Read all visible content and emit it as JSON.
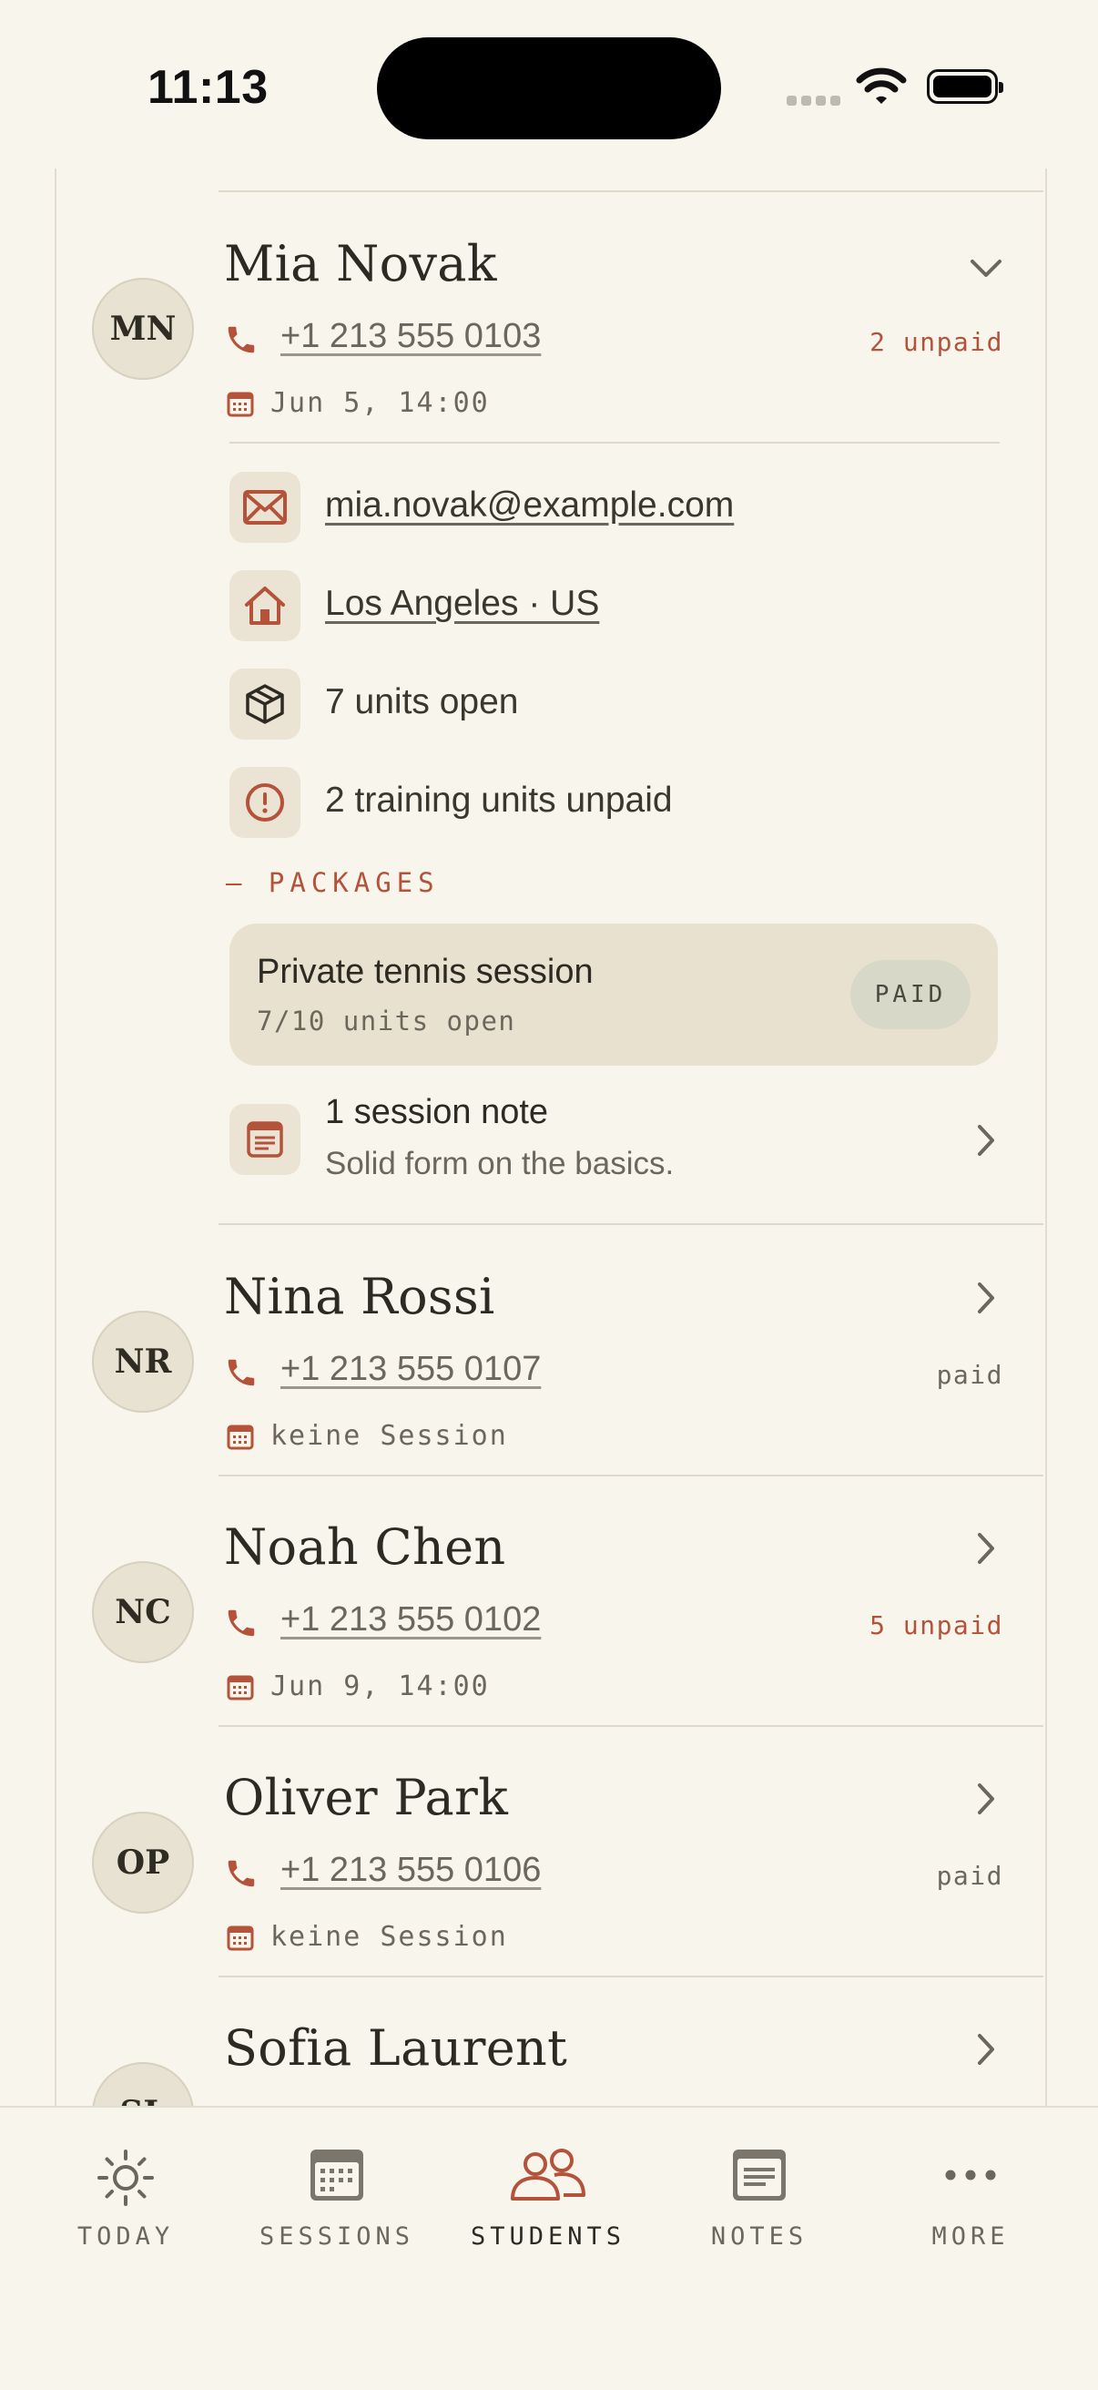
{
  "status_bar": {
    "time": "11:13"
  },
  "students": [
    {
      "initials": "MN",
      "name": "Mia Novak",
      "phone": "+1 213 555 0103",
      "payment": "2 unpaid",
      "payment_state": "unpaid",
      "next_session": "Jun 5, 14:00",
      "expanded": true,
      "details": {
        "email": "mia.novak@example.com",
        "location": "Los Angeles · US",
        "units_open": "7 units open",
        "unpaid_units": "2 training units unpaid",
        "packages_label": "— PACKAGES",
        "packages": [
          {
            "title": "Private tennis session",
            "units": "7/10 units open",
            "status": "PAID"
          }
        ],
        "note_title": "1 session note",
        "note_text": "Solid form on the basics."
      }
    },
    {
      "initials": "NR",
      "name": "Nina Rossi",
      "phone": "+1 213 555 0107",
      "payment": "paid",
      "payment_state": "paid",
      "next_session": "keine Session"
    },
    {
      "initials": "NC",
      "name": "Noah Chen",
      "phone": "+1 213 555 0102",
      "payment": "5 unpaid",
      "payment_state": "unpaid",
      "next_session": "Jun 9, 14:00"
    },
    {
      "initials": "OP",
      "name": "Oliver Park",
      "phone": "+1 213 555 0106",
      "payment": "paid",
      "payment_state": "paid",
      "next_session": "keine Session"
    },
    {
      "initials": "SL",
      "name": "Sofia Laurent"
    }
  ],
  "tabs": [
    {
      "label": "TODAY",
      "icon": "sun-icon",
      "active": false
    },
    {
      "label": "SESSIONS",
      "icon": "calendar-icon",
      "active": false
    },
    {
      "label": "STUDENTS",
      "icon": "people-icon",
      "active": true
    },
    {
      "label": "NOTES",
      "icon": "note-icon",
      "active": false
    },
    {
      "label": "MORE",
      "icon": "more-dots-icon",
      "active": false
    }
  ],
  "colors": {
    "background": "#f8f5ed",
    "accent": "#b4533a",
    "text": "#2c2a22",
    "muted": "#6b675c"
  }
}
